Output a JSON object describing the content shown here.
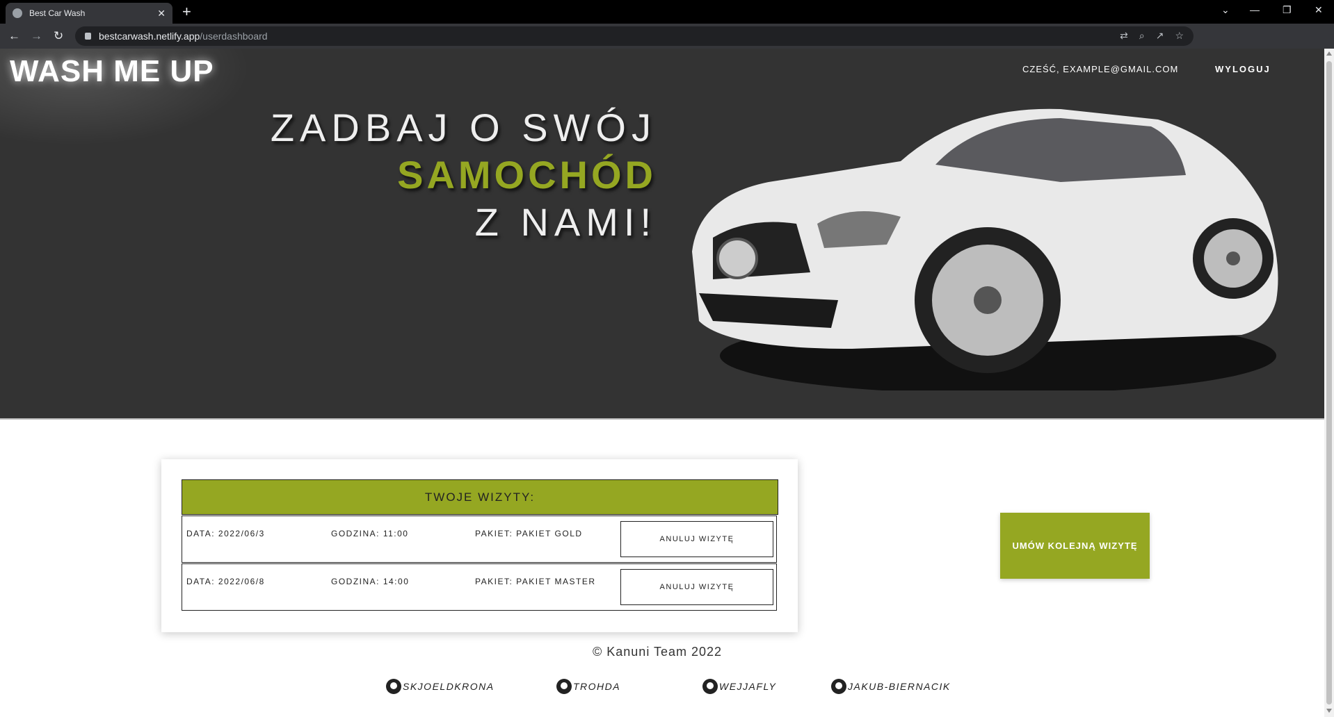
{
  "browser": {
    "tab_title": "Best Car Wash",
    "tab_close": "✕",
    "new_tab": "+",
    "url_host": "bestcarwash.netlify.app",
    "url_path": "/userdashboard",
    "win_min": "—",
    "win_restore": "❐",
    "win_close": "✕",
    "win_dropdown": "⌄"
  },
  "header": {
    "logo": "WASH ME UP",
    "greeting": "CZEŚĆ, EXAMPLE@GMAIL.COM",
    "logout": "WYLOGUJ"
  },
  "hero": {
    "line1": "ZADBAJ O SWÓJ",
    "line2": "SAMOCHÓD",
    "line3": "Z NAMI!"
  },
  "visits": {
    "title": "TWOJE WIZYTY:",
    "items": [
      {
        "date": "DATA: 2022/06/3",
        "time": "GODZINA: 11:00",
        "package": "PAKIET: PAKIET GOLD",
        "cancel": "ANULUJ WIZYTĘ"
      },
      {
        "date": "DATA: 2022/06/8",
        "time": "GODZINA: 14:00",
        "package": "PAKIET: PAKIET MASTER",
        "cancel": "ANULUJ WIZYTĘ"
      }
    ]
  },
  "book_button": "UMÓW KOLEJNĄ WIZYTĘ",
  "footer": {
    "copyright": "© Kanuni Team 2022",
    "github": [
      "SKJOELDKRONA",
      "TROHDA",
      "WEJJAFLY",
      "JAKUB-BIERNACIK"
    ]
  },
  "colors": {
    "accent": "#95a722",
    "hero_bg": "#333333"
  }
}
